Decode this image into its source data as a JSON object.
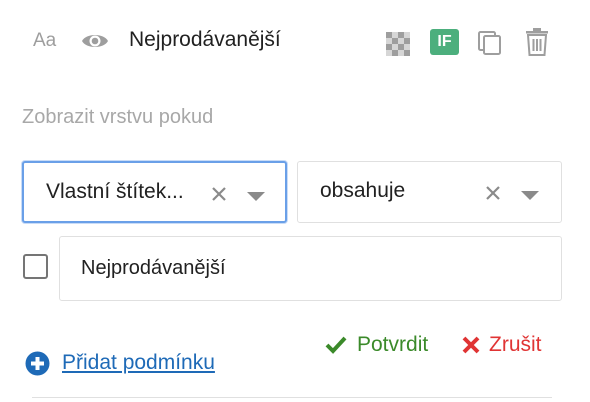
{
  "layer": {
    "text_toggle": "Aa",
    "name": "Nejprodávanější",
    "conditional_badge": "IF"
  },
  "condition": {
    "section_label": "Zobrazit vrstvu pokud",
    "field_select_value": "Vlastní štítek...",
    "operator_select_value": "obsahuje",
    "value_input": "Nejprodávanější",
    "checkbox_checked": false
  },
  "actions": {
    "confirm_label": "Potvrdit",
    "cancel_label": "Zrušit",
    "add_condition_label": "Přidat podmínku"
  },
  "colors": {
    "badge": "#4caf7d",
    "confirm": "#3b8a2a",
    "cancel": "#e03434",
    "link": "#1e6ab7",
    "focus_border": "#6aa0e8"
  }
}
